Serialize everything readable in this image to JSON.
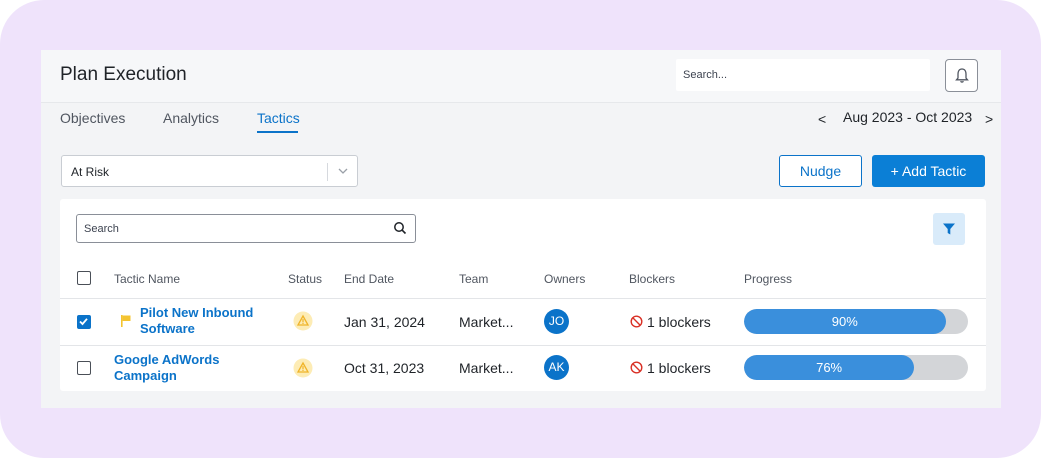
{
  "header": {
    "title": "Plan Execution",
    "search_placeholder": "Search..."
  },
  "tabs": [
    {
      "label": "Objectives"
    },
    {
      "label": "Analytics"
    },
    {
      "label": "Tactics",
      "active": true
    }
  ],
  "date_range": {
    "label": "Aug 2023 - Oct 2023",
    "prev": "<",
    "next": ">"
  },
  "toolbar": {
    "status_filter_value": "At Risk",
    "nudge_label": "Nudge",
    "add_label": "+ Add Tactic"
  },
  "table": {
    "search_placeholder": "Search",
    "columns": [
      "Tactic Name",
      "Status",
      "End Date",
      "Team",
      "Owners",
      "Blockers",
      "Progress"
    ],
    "rows": [
      {
        "checked": true,
        "flagged": true,
        "name_line1": "Pilot New Inbound",
        "name_line2": "Software",
        "status_icon": "warning-icon",
        "end_date": "Jan 31, 2024",
        "team": "Market...",
        "owner": "JO",
        "blockers": "1 blockers",
        "progress": 90,
        "progress_label": "90%"
      },
      {
        "checked": false,
        "flagged": false,
        "name_line1": "Google AdWords",
        "name_line2": "Campaign",
        "status_icon": "warning-icon",
        "end_date": "Oct 31, 2023",
        "team": "Market...",
        "owner": "AK",
        "blockers": "1 blockers",
        "progress": 76,
        "progress_label": "76%"
      }
    ]
  },
  "colors": {
    "accent": "#0b73c9",
    "background_frame": "#efe3fb",
    "progress_fill": "#3a8fdc",
    "progress_track": "#d3d5d8",
    "warning": "#f4c430",
    "blocker": "#d93025"
  }
}
